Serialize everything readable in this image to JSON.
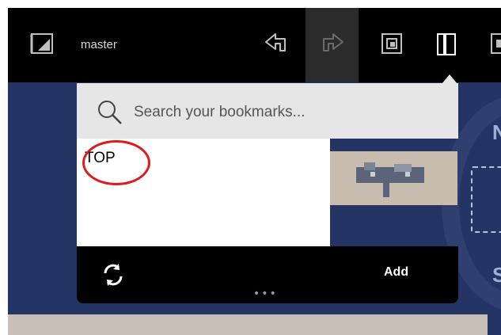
{
  "toolbar": {
    "branch_label": "master",
    "icons": [
      "panel-toggle-icon",
      "undo-icon",
      "redo-icon",
      "window-icon",
      "bookmark-icon",
      "layout-icon"
    ]
  },
  "bookmarks_popup": {
    "search": {
      "placeholder": "Search your bookmarks..."
    },
    "items": [
      {
        "label": "TOP"
      }
    ],
    "footer": {
      "add_label": "Add",
      "more_label": "•••"
    }
  },
  "colors": {
    "canvas": "#243565",
    "toolbar": "#000000",
    "popup_search_bg": "#e6e6e6",
    "annotation": "#e01b1b"
  }
}
